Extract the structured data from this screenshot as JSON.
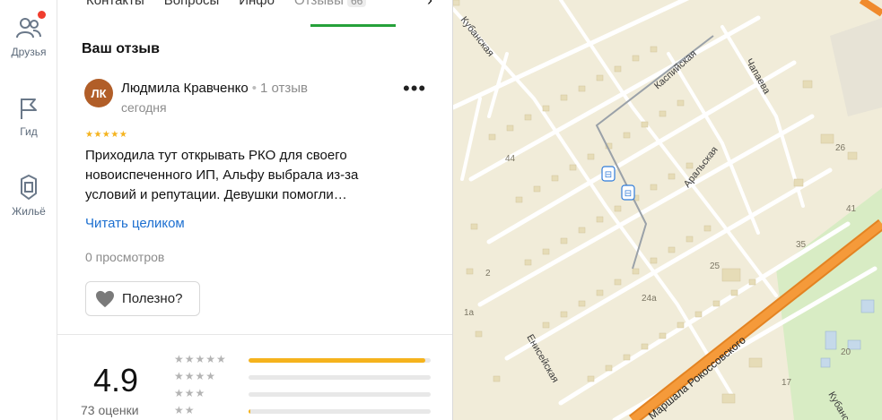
{
  "rail": {
    "friends": "Друзья",
    "guide": "Гид",
    "housing": "Жильё"
  },
  "tabs": [
    {
      "label": "Контакты"
    },
    {
      "label": "Вопросы"
    },
    {
      "label": "Инфо"
    },
    {
      "label": "Отзывы",
      "badge": "66"
    }
  ],
  "review_section": {
    "title": "Ваш отзыв",
    "avatar_initials": "ЛК",
    "author": "Людмила Кравченко",
    "separator": "•",
    "author_reviews": "1 отзыв",
    "date": "сегодня",
    "stars": "★★★★★",
    "text": "Приходила тут открывать РКО для своего новоиспеченного ИП, Альфу выбрала из-за условий и репутации. Девушки помогли…",
    "read_more": "Читать целиком",
    "views": "0 просмотров",
    "useful": "Полезно?"
  },
  "rating": {
    "score": "4.9",
    "count": "73 оценки",
    "distribution": [
      {
        "stars": "★★★★★",
        "fraction": 0.97
      },
      {
        "stars": "★★★★",
        "fraction": 0
      },
      {
        "stars": "★★★",
        "fraction": 0
      },
      {
        "stars": "★★",
        "fraction": 0.01
      }
    ]
  },
  "map": {
    "streets": [
      "Кубанская",
      "Каспийская",
      "Чапаева",
      "Аральская",
      "Енисейская",
      "Маршала Рокоссовского",
      "Кубанская"
    ],
    "numbers": [
      "44",
      "26",
      "41",
      "35",
      "25",
      "24а",
      "2",
      "1а",
      "20",
      "17"
    ],
    "colors": {
      "land": "#f1ecd9",
      "building": "#e9e1c4",
      "road": "#ffffff",
      "highway": "#f08a2c",
      "park": "#d8ecc4",
      "transit": "#2f7bd9"
    }
  }
}
